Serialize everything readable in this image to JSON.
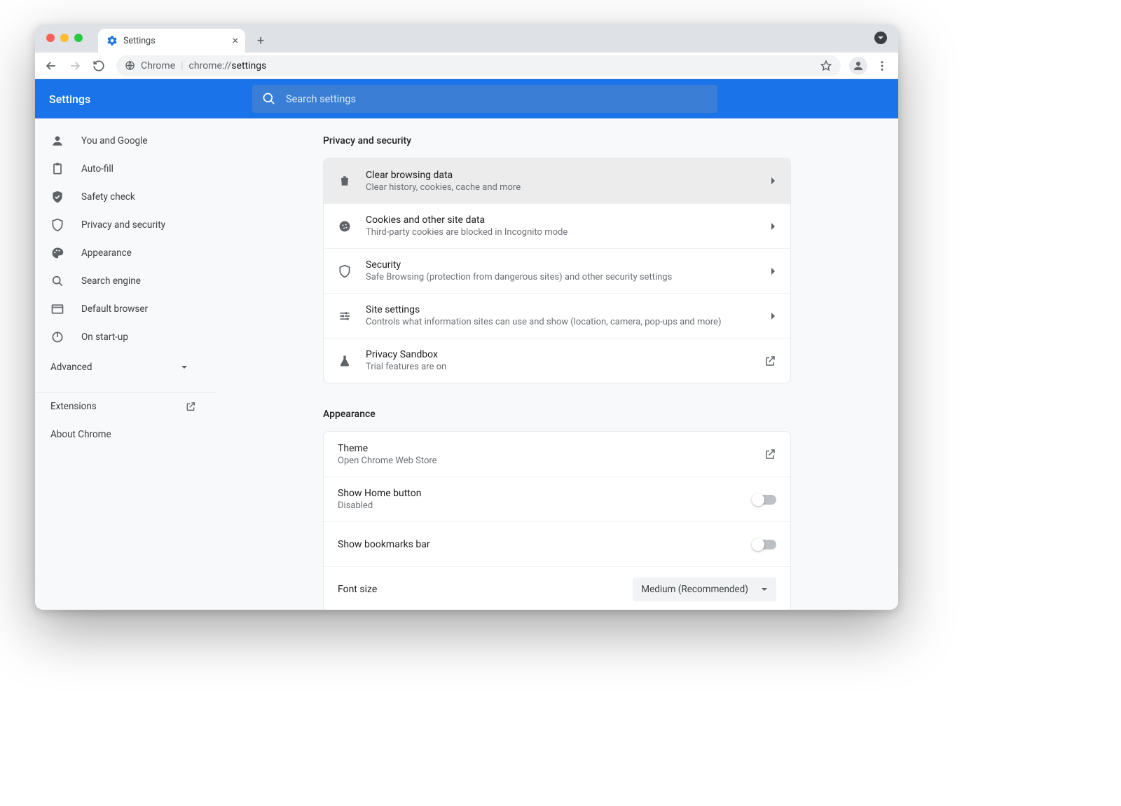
{
  "tab": {
    "title": "Settings"
  },
  "addressbar": {
    "origin_label": "Chrome",
    "scheme": "chrome://",
    "path": "settings"
  },
  "header": {
    "brand": "Settings",
    "search_placeholder": "Search settings"
  },
  "sidebar": {
    "items": [
      {
        "label": "You and Google"
      },
      {
        "label": "Auto-fill"
      },
      {
        "label": "Safety check"
      },
      {
        "label": "Privacy and security"
      },
      {
        "label": "Appearance"
      },
      {
        "label": "Search engine"
      },
      {
        "label": "Default browser"
      },
      {
        "label": "On start-up"
      }
    ],
    "advanced_label": "Advanced",
    "extensions_label": "Extensions",
    "about_label": "About Chrome"
  },
  "sections": {
    "privacy": {
      "title": "Privacy and security",
      "rows": [
        {
          "title": "Clear browsing data",
          "sub": "Clear history, cookies, cache and more"
        },
        {
          "title": "Cookies and other site data",
          "sub": "Third-party cookies are blocked in Incognito mode"
        },
        {
          "title": "Security",
          "sub": "Safe Browsing (protection from dangerous sites) and other security settings"
        },
        {
          "title": "Site settings",
          "sub": "Controls what information sites can use and show (location, camera, pop-ups and more)"
        },
        {
          "title": "Privacy Sandbox",
          "sub": "Trial features are on"
        }
      ]
    },
    "appearance": {
      "title": "Appearance",
      "rows": {
        "theme_title": "Theme",
        "theme_sub": "Open Chrome Web Store",
        "home_title": "Show Home button",
        "home_sub": "Disabled",
        "bookmarks_title": "Show bookmarks bar",
        "fontsize_title": "Font size",
        "fontsize_value": "Medium (Recommended)"
      }
    }
  }
}
